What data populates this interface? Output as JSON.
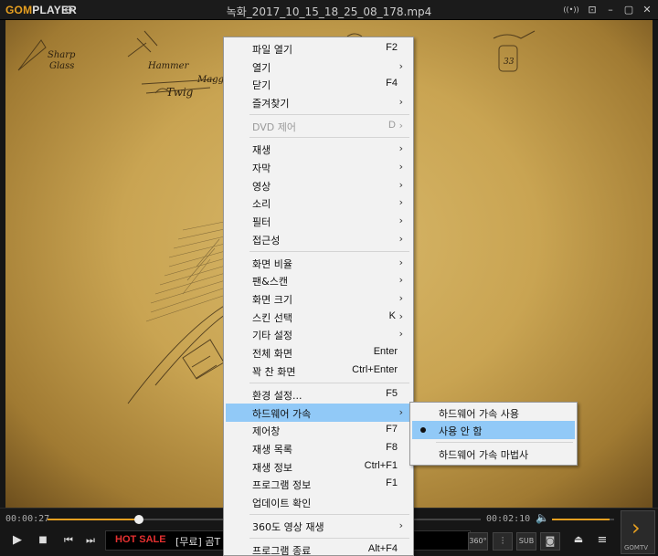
{
  "app": {
    "logo_brand": "GOM",
    "logo_rest": "PLAYER",
    "window_title": "녹화_2017_10_15_18_25_08_178.mp4",
    "window_buttons": [
      "((•))",
      "⊡",
      "–",
      "▢",
      "✕"
    ]
  },
  "video": {
    "sketch_labels": {
      "sharp_glass": "Sharp Glass",
      "hammer": "Hammer",
      "twig": "Twig",
      "magg": "Magg",
      "tag": "33"
    }
  },
  "controls": {
    "current_time": "00:00:27",
    "total_time": "00:02:10",
    "seek_fraction": 0.21,
    "volume_fraction": 0.92,
    "ticker_hot": "HOT SALE",
    "ticker_message": "[무료] 곰T",
    "btn_360": "360°",
    "btn_sub": "SUB",
    "gomtv_label": "GOMTV"
  },
  "menu": {
    "items": [
      {
        "label": "파일 열기",
        "key": "F2",
        "arrow": ""
      },
      {
        "label": "열기",
        "key": "",
        "arrow": "›"
      },
      {
        "label": "닫기",
        "key": "F4",
        "arrow": ""
      },
      {
        "label": "즐겨찾기",
        "key": "",
        "arrow": "›"
      },
      {
        "label": "DVD 제어",
        "key": "D",
        "arrow": "›"
      },
      {
        "label": "재생",
        "key": "",
        "arrow": "›"
      },
      {
        "label": "자막",
        "key": "",
        "arrow": "›"
      },
      {
        "label": "영상",
        "key": "",
        "arrow": "›"
      },
      {
        "label": "소리",
        "key": "",
        "arrow": "›"
      },
      {
        "label": "필터",
        "key": "",
        "arrow": "›"
      },
      {
        "label": "접근성",
        "key": "",
        "arrow": "›"
      },
      {
        "label": "화면 비율",
        "key": "",
        "arrow": "›"
      },
      {
        "label": "팬&스캔",
        "key": "",
        "arrow": "›"
      },
      {
        "label": "화면 크기",
        "key": "",
        "arrow": "›"
      },
      {
        "label": "스킨 선택",
        "key": "K",
        "arrow": "›"
      },
      {
        "label": "기타 설정",
        "key": "",
        "arrow": "›"
      },
      {
        "label": "전체 화면",
        "key": "Enter",
        "arrow": ""
      },
      {
        "label": "꽉 찬 화면",
        "key": "Ctrl+Enter",
        "arrow": ""
      },
      {
        "label": "환경 설정...",
        "key": "F5",
        "arrow": ""
      },
      {
        "label": "하드웨어 가속",
        "key": "",
        "arrow": "›"
      },
      {
        "label": "제어창",
        "key": "F7",
        "arrow": ""
      },
      {
        "label": "재생 목록",
        "key": "F8",
        "arrow": ""
      },
      {
        "label": "재생 정보",
        "key": "Ctrl+F1",
        "arrow": ""
      },
      {
        "label": "프로그램 정보",
        "key": "F1",
        "arrow": ""
      },
      {
        "label": "업데이트 확인",
        "key": "",
        "arrow": ""
      },
      {
        "label": "360도 영상 재생",
        "key": "",
        "arrow": "›"
      },
      {
        "label": "프로그램 종료",
        "key": "Alt+F4",
        "arrow": ""
      }
    ]
  },
  "submenu": {
    "items": [
      {
        "label": "하드웨어 가속 사용"
      },
      {
        "label": "사용 안 함"
      },
      {
        "label": "하드웨어 가속 마법사"
      }
    ]
  }
}
